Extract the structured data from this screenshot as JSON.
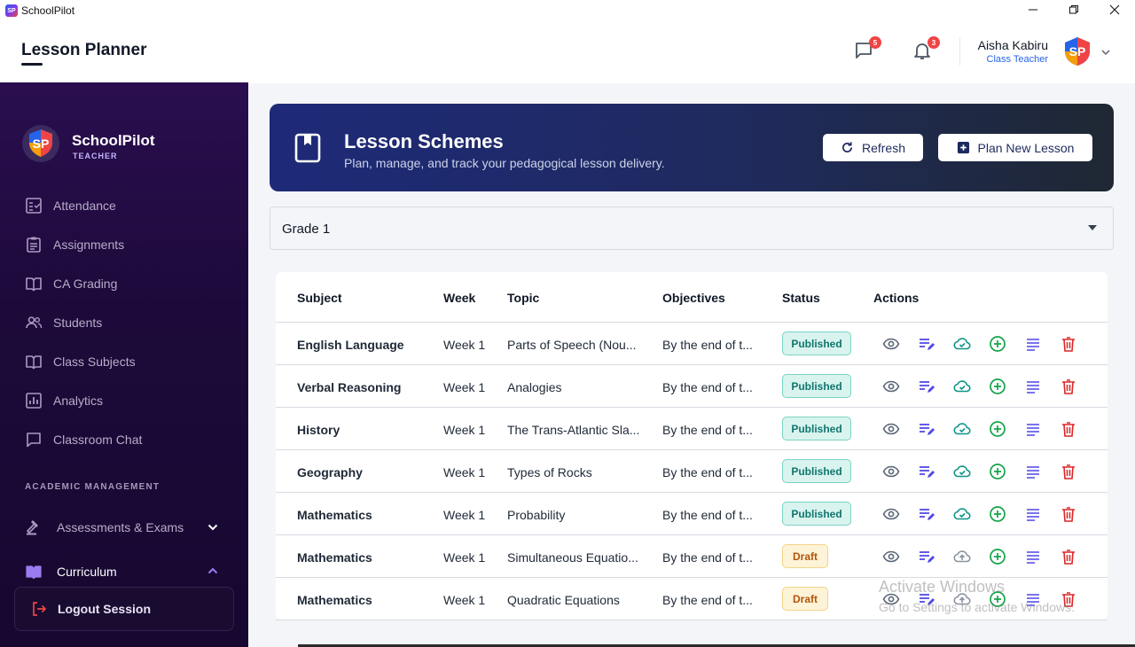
{
  "window": {
    "app_name": "SchoolPilot",
    "controls": {
      "minimize": "—",
      "maximize": "❐",
      "close": "✕"
    }
  },
  "header": {
    "page_title": "Lesson Planner",
    "messages_count": "5",
    "notifications_count": "3",
    "user_name": "Aisha Kabiru",
    "user_role": "Class Teacher"
  },
  "sidebar": {
    "brand_name": "SchoolPilot",
    "brand_role": "TEACHER",
    "items": [
      {
        "label": "Attendance",
        "icon": "attendance-icon"
      },
      {
        "label": "Assignments",
        "icon": "assignments-icon"
      },
      {
        "label": "CA Grading",
        "icon": "book-open-icon"
      },
      {
        "label": "Students",
        "icon": "students-icon"
      },
      {
        "label": "Class Subjects",
        "icon": "book-open-icon"
      },
      {
        "label": "Analytics",
        "icon": "analytics-icon"
      },
      {
        "label": "Classroom Chat",
        "icon": "chat-icon"
      }
    ],
    "section_title": "ACADEMIC MANAGEMENT",
    "section_items": [
      {
        "label": "Assessments & Exams",
        "icon": "gavel-icon",
        "expanded": false
      },
      {
        "label": "Curriculum",
        "icon": "curriculum-icon",
        "expanded": true
      }
    ],
    "logout_label": "Logout Session"
  },
  "hero": {
    "title": "Lesson Schemes",
    "subtitle": "Plan, manage, and track your pedagogical lesson delivery.",
    "refresh_label": "Refresh",
    "plan_label": "Plan New Lesson"
  },
  "filter": {
    "grade": "Grade 1"
  },
  "table": {
    "headers": {
      "subject": "Subject",
      "week": "Week",
      "topic": "Topic",
      "objectives": "Objectives",
      "status": "Status",
      "actions": "Actions"
    },
    "rows": [
      {
        "subject": "English Language",
        "week": "Week 1",
        "topic": "Parts of Speech (Nou...",
        "objectives": "By the end of t...",
        "status": "Published"
      },
      {
        "subject": "Verbal Reasoning",
        "week": "Week 1",
        "topic": "Analogies",
        "objectives": "By the end of t...",
        "status": "Published"
      },
      {
        "subject": "History",
        "week": "Week 1",
        "topic": "The Trans-Atlantic Sla...",
        "objectives": "By the end of t...",
        "status": "Published"
      },
      {
        "subject": "Geography",
        "week": "Week 1",
        "topic": "Types of Rocks",
        "objectives": "By the end of t...",
        "status": "Published"
      },
      {
        "subject": "Mathematics",
        "week": "Week 1",
        "topic": "Probability",
        "objectives": "By the end of t...",
        "status": "Published"
      },
      {
        "subject": "Mathematics",
        "week": "Week 1",
        "topic": "Simultaneous Equatio...",
        "objectives": "By the end of t...",
        "status": "Draft"
      },
      {
        "subject": "Mathematics",
        "week": "Week 1",
        "topic": "Quadratic Equations",
        "objectives": "By the end of t...",
        "status": "Draft"
      }
    ]
  },
  "watermark": {
    "line1": "Activate Windows",
    "line2": "Go to Settings to activate Windows."
  },
  "colors": {
    "sidebar_bg": "#1d0a3a",
    "hero_bg": "#1e2a78",
    "published": "#0f766e",
    "draft": "#b45309",
    "view": "#5b6677",
    "edit": "#4f46e5",
    "publish": "#0d9488",
    "add": "#16a34a",
    "details": "#4f46e5",
    "delete": "#dc2626"
  }
}
